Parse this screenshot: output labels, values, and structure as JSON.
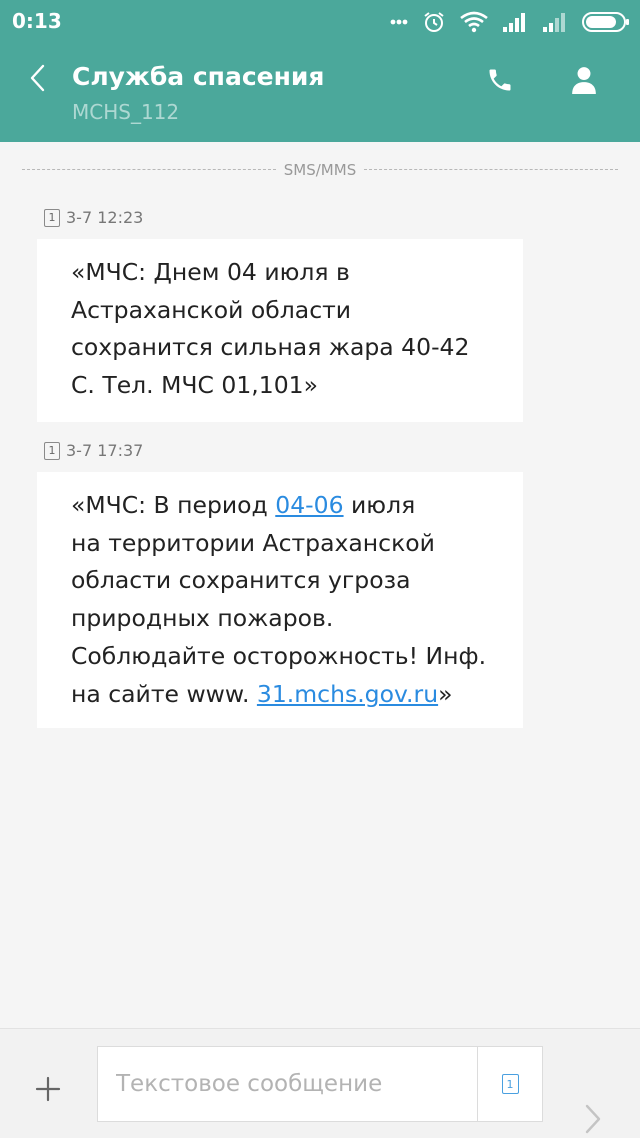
{
  "status_bar": {
    "time": "0:13",
    "icons": [
      "more-dots-icon",
      "alarm-icon",
      "wifi-icon",
      "signal-icon",
      "signal-icon",
      "battery-icon"
    ]
  },
  "header": {
    "title": "Служба спасения",
    "subtitle": "MCHS_112",
    "icons": [
      "back-arrow-icon",
      "phone-icon",
      "contact-person-icon"
    ],
    "color": "#4ba89b"
  },
  "divider_label": "SMS/MMS",
  "messages": [
    {
      "sim": "1",
      "timestamp": "3-7 12:23",
      "lines": [
        "«МЧС: Днем 04 июля в",
        "Астраханской области",
        "сохранится сильная жара 40-42",
        "С. Тел. МЧС 01,101»"
      ]
    },
    {
      "sim": "1",
      "timestamp": "3-7 17:37",
      "lines": {
        "l1_pre": "«МЧС: В период ",
        "l1_link": "04-06",
        "l1_post": " июля",
        "l2": "на территории  Астраханской",
        "l3": "области сохранится угроза",
        "l4": "природных пожаров.",
        "l5": "Соблюдайте осторожность! Инф.",
        "l6_pre": "на сайте www. ",
        "l6_link": "31.mchs.gov.ru",
        "l6_post": "»"
      }
    }
  ],
  "input_bar": {
    "placeholder": "Текстовое сообщение",
    "sim": "1",
    "icons": [
      "plus-icon",
      "sim-card-icon",
      "send-arrow-icon"
    ]
  },
  "colors": {
    "link": "#2a8be0",
    "background": "#f5f5f5"
  }
}
